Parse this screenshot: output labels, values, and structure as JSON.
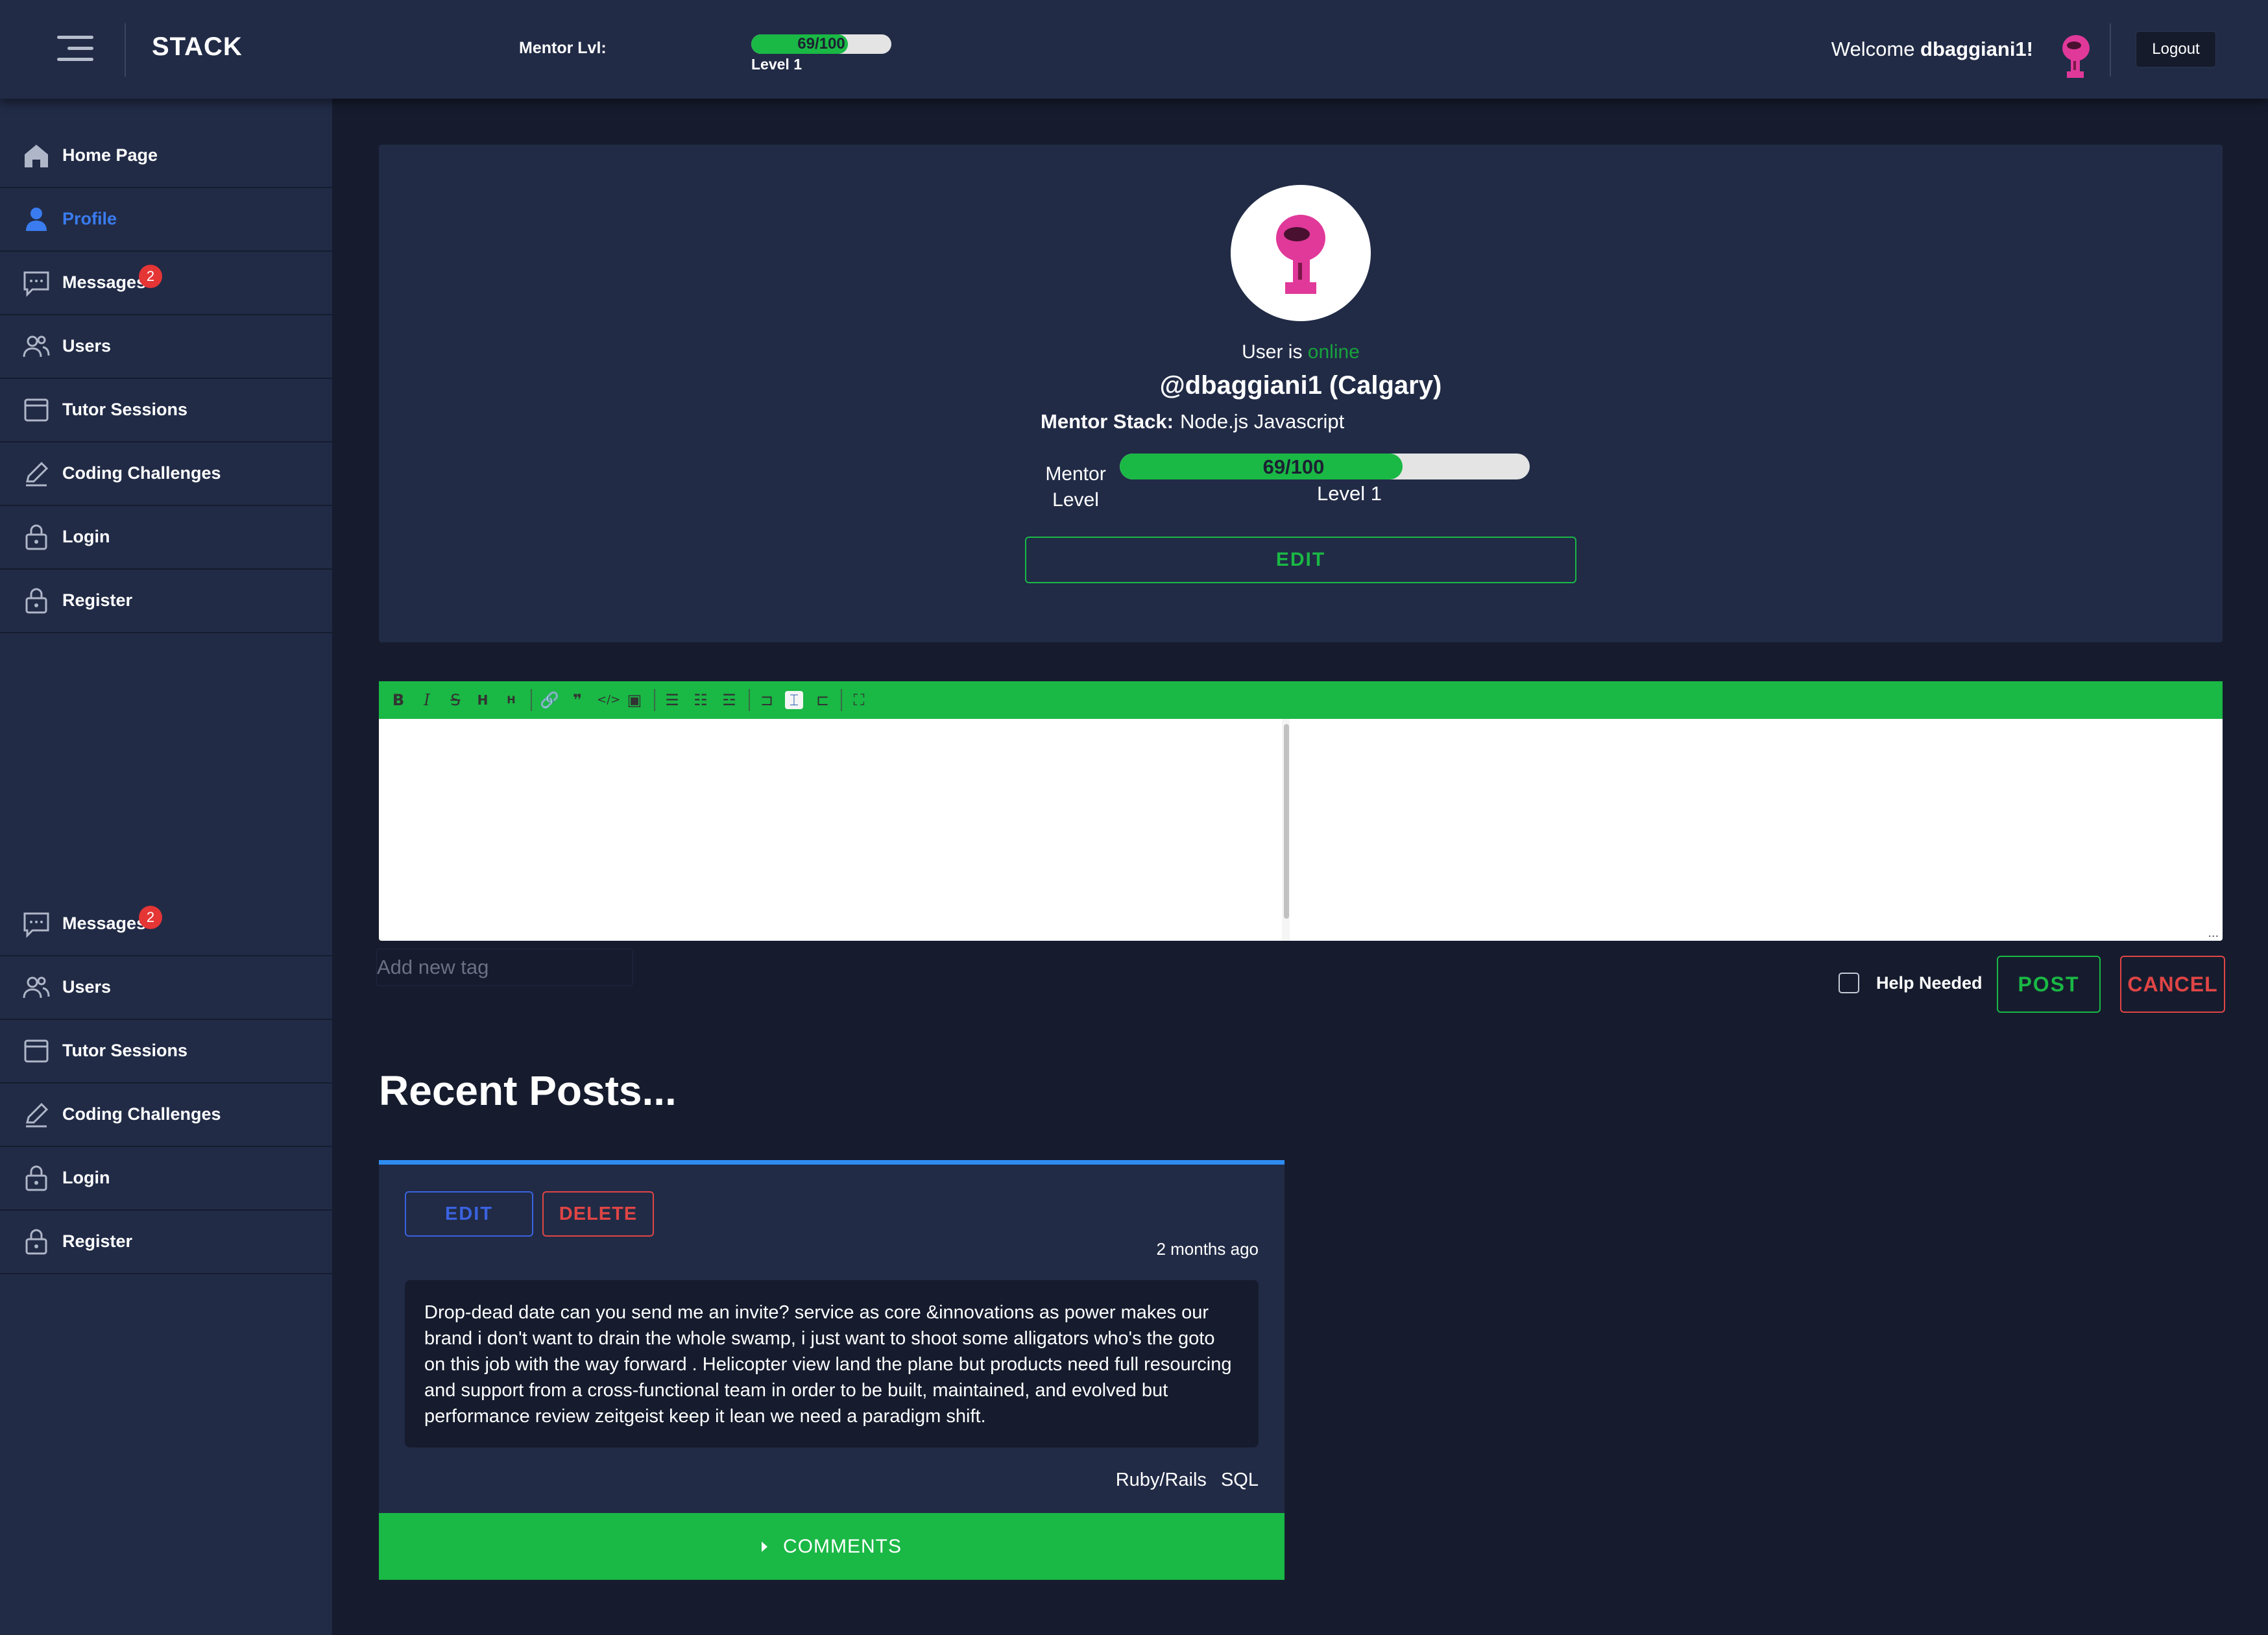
{
  "header": {
    "brand": "STACK",
    "mentor_label": "Mentor Lvl:",
    "progress_text": "69/100",
    "progress_fraction": 0.69,
    "level_text": "Level 1",
    "welcome_prefix": "Welcome ",
    "username": "dbaggiani1!",
    "logout_label": "Logout"
  },
  "sidebar": {
    "items": [
      {
        "label": "Home Page",
        "icon": "home-icon"
      },
      {
        "label": "Profile",
        "icon": "user-icon",
        "active": true
      },
      {
        "label": "Messages",
        "icon": "message-icon",
        "badge": "2"
      },
      {
        "label": "Users",
        "icon": "users-icon"
      },
      {
        "label": "Tutor Sessions",
        "icon": "window-icon"
      },
      {
        "label": "Coding Challenges",
        "icon": "pencil-icon"
      },
      {
        "label": "Login",
        "icon": "lock-icon"
      },
      {
        "label": "Register",
        "icon": "lock-icon"
      }
    ],
    "items_lower": [
      {
        "label": "Messages",
        "icon": "message-icon",
        "badge": "2"
      },
      {
        "label": "Users",
        "icon": "users-icon"
      },
      {
        "label": "Tutor Sessions",
        "icon": "window-icon"
      },
      {
        "label": "Coding Challenges",
        "icon": "pencil-icon"
      },
      {
        "label": "Login",
        "icon": "lock-icon"
      },
      {
        "label": "Register",
        "icon": "lock-icon"
      }
    ]
  },
  "profile": {
    "status_prefix": "User is ",
    "status": "online",
    "handle": "@dbaggiani1 (Calgary)",
    "stack_label": "Mentor Stack:",
    "stack_value": "Node.js Javascript",
    "mentor_level_label": "Mentor Level",
    "progress_text": "69/100",
    "progress_fraction": 0.69,
    "level_text": "Level 1",
    "edit_label": "EDIT"
  },
  "editor": {
    "toolbar": [
      "bold-icon",
      "italic-icon",
      "strikethrough-icon",
      "heading-icon",
      "heading-smaller-icon",
      "link-icon",
      "quote-icon",
      "code-icon",
      "image-icon",
      "unordered-list-icon",
      "ordered-list-icon",
      "checklist-icon",
      "preview-icon",
      "side-by-side-icon",
      "fullscreen-side-icon",
      "fullscreen-icon"
    ],
    "corner": "..."
  },
  "post_form": {
    "tag_placeholder": "Add new tag",
    "help_label": "Help Needed",
    "post_label": "POST",
    "cancel_label": "CANCEL"
  },
  "recent": {
    "title": "Recent Posts...",
    "posts": [
      {
        "edit_label": "EDIT",
        "delete_label": "DELETE",
        "time": "2 months ago",
        "body": "Drop-dead date can you send me an invite? service as core &innovations as power makes our brand i don't want to drain the whole swamp, i just want to shoot some alligators who's the goto on this job with the way forward . Helicopter view land the plane but products need full resourcing and support from a cross-functional team in order to be built, maintained, and evolved but performance review zeitgeist keep it lean we need a paradigm shift.",
        "tags": [
          "Ruby/Rails",
          "SQL"
        ],
        "comments_label": "COMMENTS"
      }
    ]
  },
  "colors": {
    "accent_green": "#1ab845",
    "primary_blue": "#3a63e0",
    "danger_red": "#e04545",
    "panel_bg": "#212b46",
    "page_bg": "#161c2e"
  }
}
